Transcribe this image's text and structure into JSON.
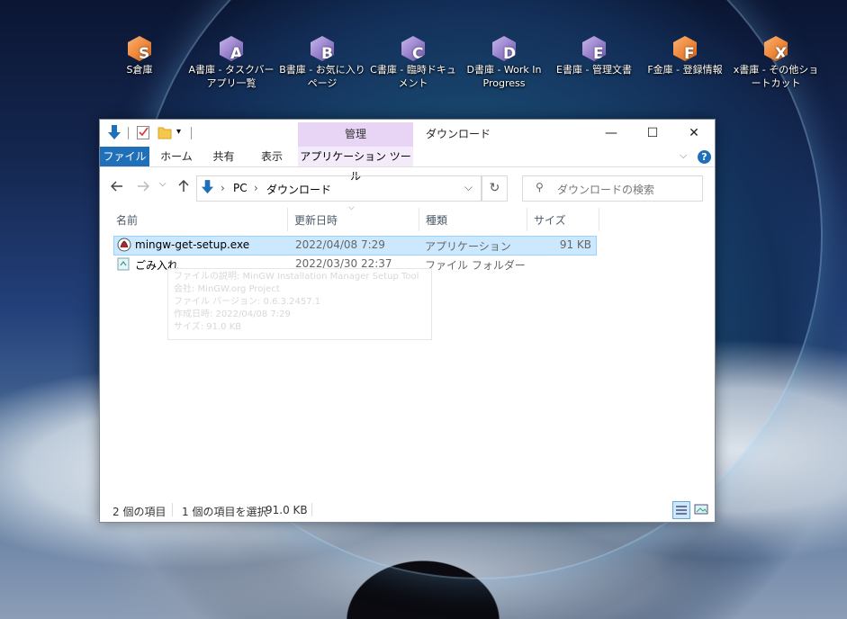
{
  "desktop": {
    "icons": [
      {
        "letter": "S",
        "label": "S倉庫",
        "color": "orange"
      },
      {
        "letter": "A",
        "label": "A書庫 - タスクバーアプリ一覧",
        "color": "purple"
      },
      {
        "letter": "B",
        "label": "B書庫 - お気に入りページ",
        "color": "purple"
      },
      {
        "letter": "C",
        "label": "C書庫 - 臨時ドキュメント",
        "color": "purple"
      },
      {
        "letter": "D",
        "label": "D書庫 - Work In Progress",
        "color": "purple"
      },
      {
        "letter": "E",
        "label": "E書庫 - 管理文書",
        "color": "purple"
      },
      {
        "letter": "F",
        "label": "F金庫 - 登録情報",
        "color": "orange"
      },
      {
        "letter": "X",
        "label": "x書庫 - その他ショートカット",
        "color": "orange"
      }
    ]
  },
  "window": {
    "title": "ダウンロード",
    "manage_tab": "管理",
    "app_tools_tab": "アプリケーション ツール",
    "ribbon_tabs": [
      "ファイル",
      "ホーム",
      "共有",
      "表示"
    ],
    "help_label": "?",
    "address": {
      "root": "PC",
      "sep": "›",
      "folder": "ダウンロード"
    },
    "search_placeholder": "ダウンロードの検索",
    "columns": [
      "名前",
      "更新日時",
      "種類",
      "サイズ"
    ],
    "files": [
      {
        "name": "mingw-get-setup.exe",
        "date": "2022/04/08 7:29",
        "type": "アプリケーション",
        "size": "91 KB",
        "icon": "mingw-app-icon",
        "selected": true
      },
      {
        "name": "ごみ入れ",
        "date": "2022/03/30 22:37",
        "type": "ファイル フォルダー",
        "size": "",
        "icon": "recycle-folder-icon",
        "selected": false
      }
    ],
    "tooltip": [
      "ファイルの説明: MinGW Installation Manager Setup Tool",
      "会社: MinGW.org Project",
      "ファイル バージョン: 0.6.3.2457.1",
      "作成日時: 2022/04/08 7:29",
      "サイズ: 91.0 KB"
    ],
    "status": {
      "items": "2 個の項目",
      "selected": "1 個の項目を選択",
      "size": "91.0 KB"
    }
  },
  "colors": {
    "accent": "#1f6fb9",
    "manage_tab": "#e8d5f5",
    "selection": "#cce8ff"
  }
}
